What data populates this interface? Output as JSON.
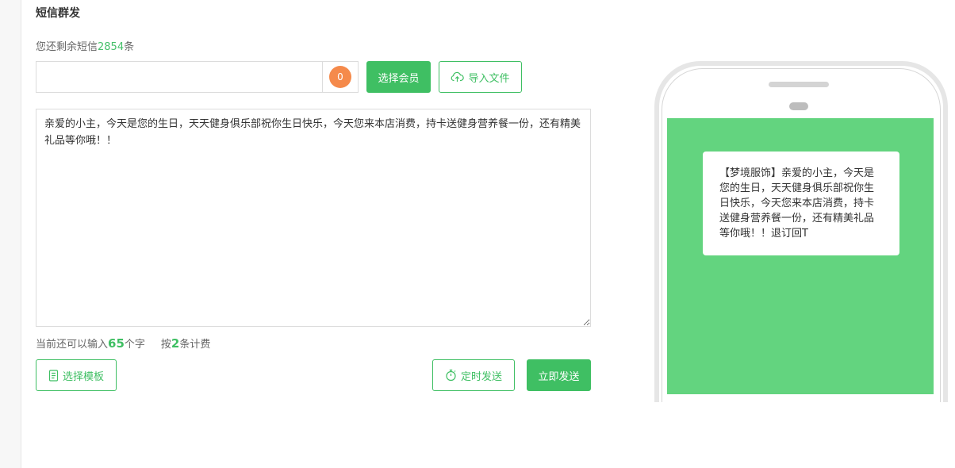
{
  "page": {
    "title": "短信群发"
  },
  "remaining": {
    "prefix": "您还剩余短信",
    "count": "2854",
    "suffix": "条"
  },
  "recipients": {
    "value": "",
    "placeholder": "",
    "count": "0"
  },
  "buttons": {
    "select_member": "选择会员",
    "import_file": "导入文件",
    "select_template": "选择模板",
    "timed_send": "定时发送",
    "send_now": "立即发送"
  },
  "message": {
    "content": "亲爱的小主，今天是您的生日，天天健身俱乐部祝你生日快乐，今天您来本店消费，持卡送健身营养餐一份，还有精美礼品等你哦！！"
  },
  "char_info": {
    "prefix": "当前还可以输入",
    "remaining_chars": "65",
    "chars_suffix": "个字",
    "billing_prefix": "按",
    "billing_count": "2",
    "billing_suffix": "条计费"
  },
  "preview": {
    "text": "【梦境服饰】亲爱的小主，今天是您的生日，天天健身俱乐部祝你生日快乐，今天您来本店消费，持卡送健身营养餐一份，还有精美礼品等你哦！！退订回T"
  },
  "colors": {
    "accent": "#3fbf63",
    "badge": "#f58a4b",
    "phone_screen": "#63d47f"
  },
  "icons": {
    "import": "cloud-upload-icon",
    "template": "document-icon",
    "timer": "stopwatch-icon"
  }
}
